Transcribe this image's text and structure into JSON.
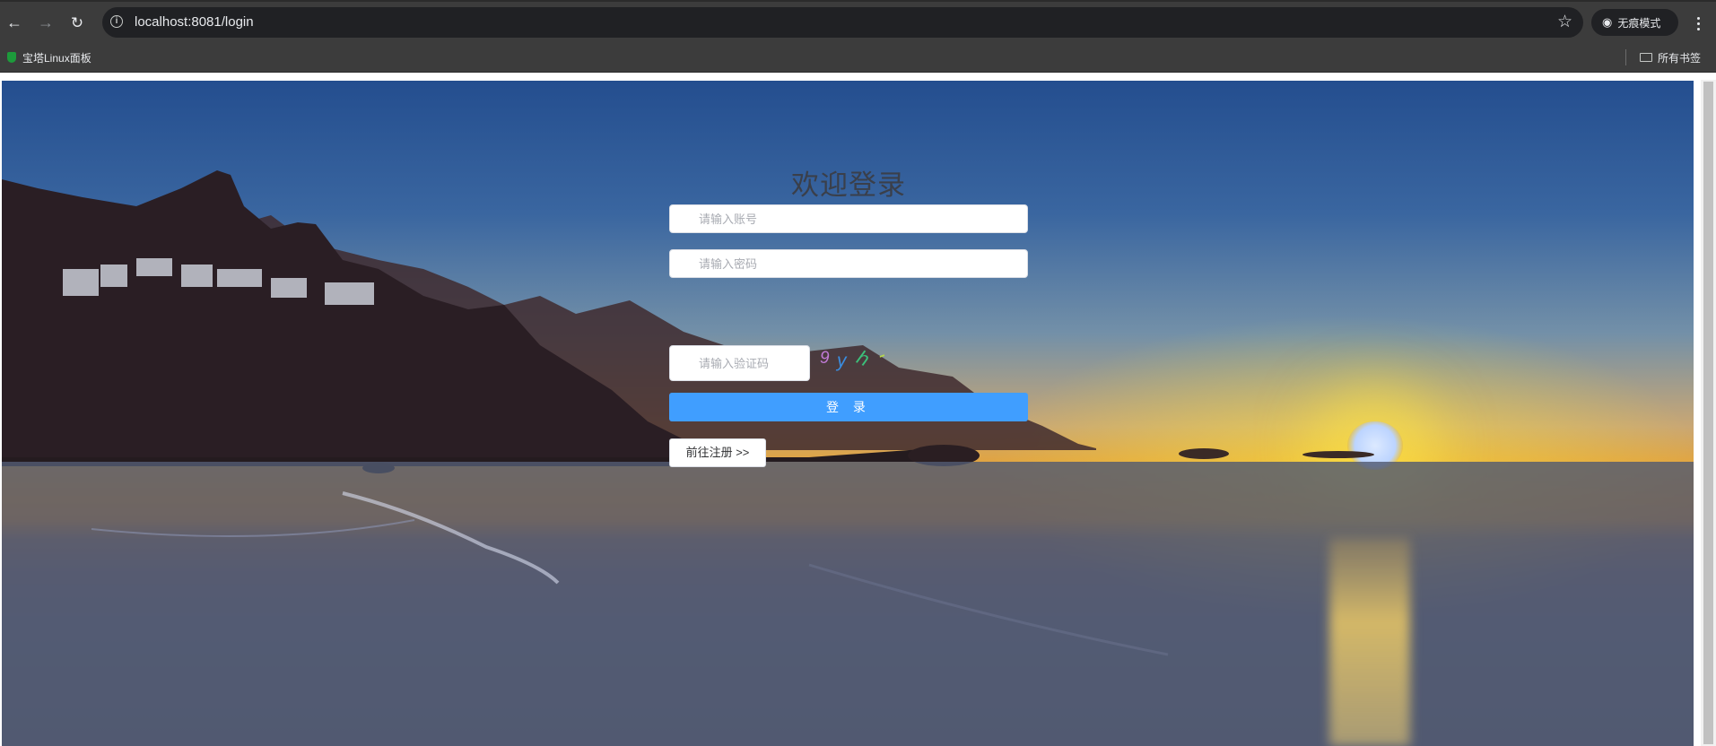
{
  "browser": {
    "url": "localhost:8081/login",
    "incognito_label": "无痕模式",
    "bookmarks": [
      {
        "label": "宝塔Linux面板"
      }
    ],
    "all_bookmarks_label": "所有书签"
  },
  "login": {
    "title": "欢迎登录",
    "account_placeholder": "请输入账号",
    "password_placeholder": "请输入密码",
    "captcha_placeholder": "请输入验证码",
    "captcha_chars": [
      {
        "char": "9",
        "color": "#c07ad6"
      },
      {
        "char": "y",
        "color": "#3a8de0"
      },
      {
        "char": "h",
        "color": "#3cc07a"
      },
      {
        "char": "-",
        "color": "#b7d94a"
      }
    ],
    "login_button": "登 录",
    "register_button": "前往注册 >>"
  },
  "colors": {
    "primary": "#409eff",
    "chrome": "#3c3c3c"
  }
}
